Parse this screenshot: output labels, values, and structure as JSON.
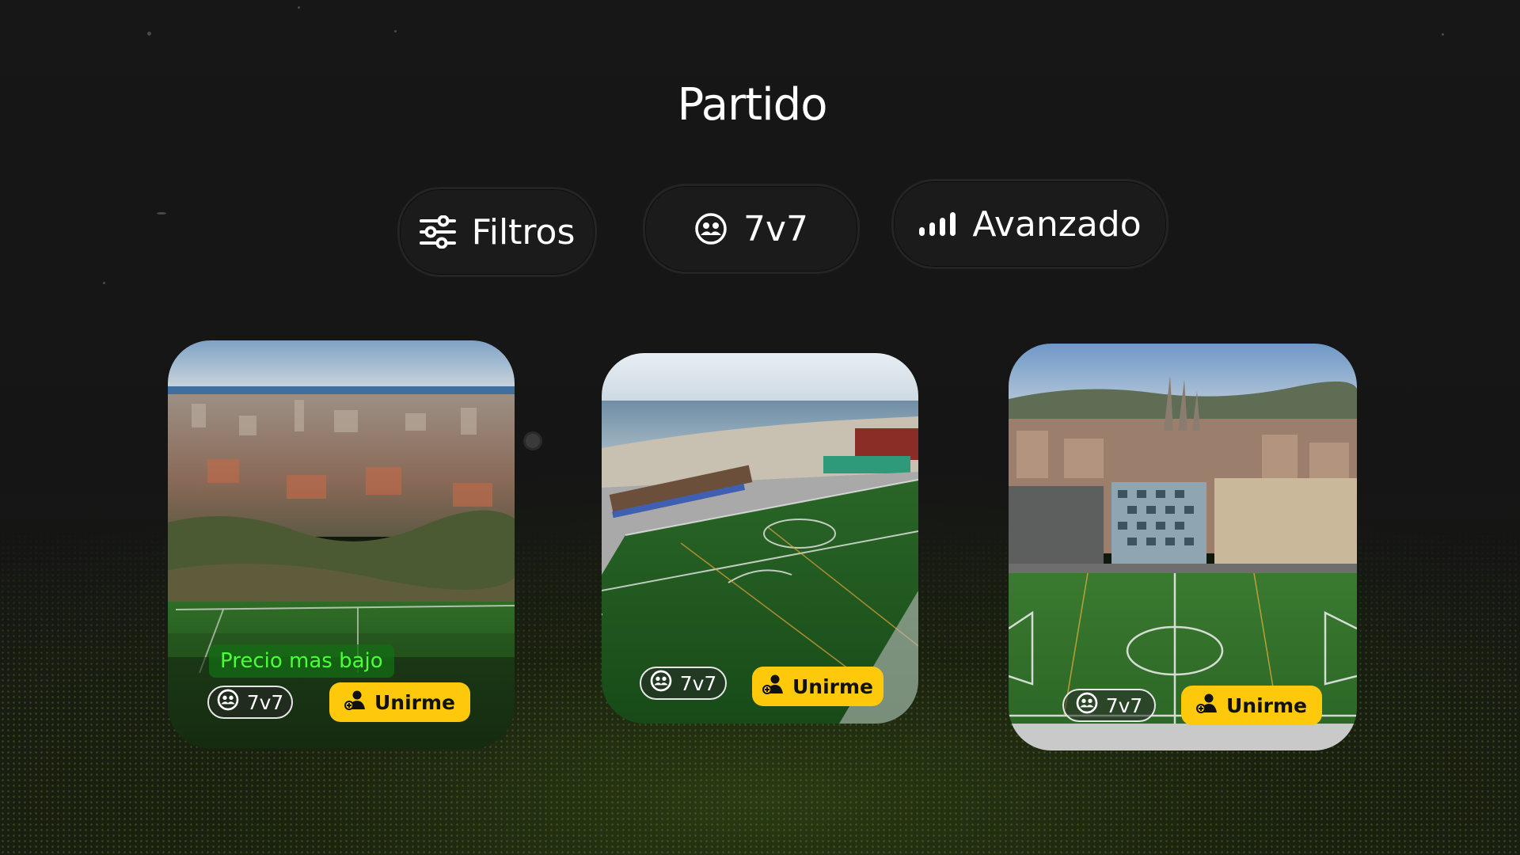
{
  "page": {
    "title": "Partido"
  },
  "filters": {
    "filters_label": "Filtros",
    "mode_label": "7v7",
    "level_label": "Avanzado",
    "filters_icon": "sliders-icon",
    "mode_icon": "group-icon",
    "level_icon": "signal-bars-icon"
  },
  "cards": [
    {
      "badge": "Precio mas bajo",
      "mode": "7v7",
      "join_label": "Unirme",
      "image": "Aerial view of city with football pitch in foreground"
    },
    {
      "mode": "7v7",
      "join_label": "Unirme",
      "image": "Aerial view of seaside football stadium"
    },
    {
      "mode": "7v7",
      "join_label": "Unirme",
      "image": "Aerial view of city with cathedral and football pitch"
    }
  ],
  "colors": {
    "background": "#151515",
    "accent": "#fdc90a",
    "badge_text": "#4cff3a",
    "pitch": "#2f6b2a"
  }
}
